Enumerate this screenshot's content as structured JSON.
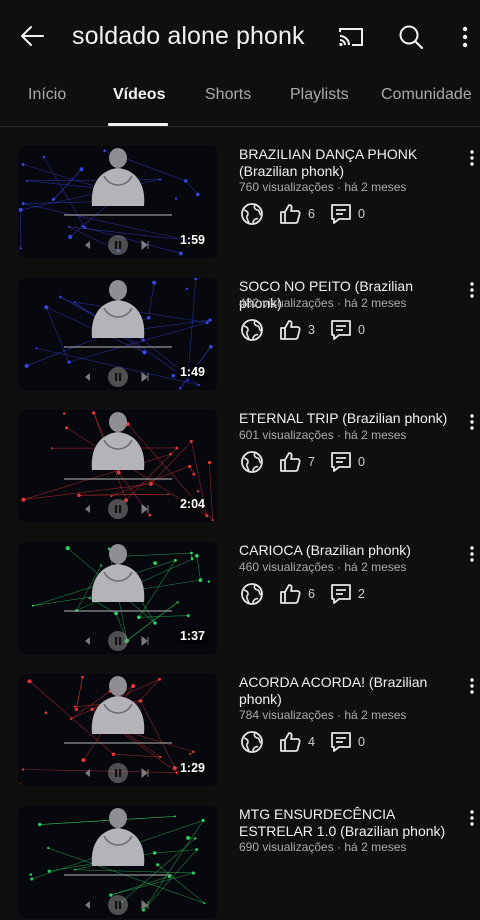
{
  "header": {
    "title": "soldado alone phonk"
  },
  "icons": {
    "back": "arrow-left-icon",
    "cast": "cast-icon",
    "search": "search-icon",
    "more": "more-vertical-icon",
    "globe": "globe-icon",
    "like": "thumbs-up-icon",
    "comment": "comment-icon"
  },
  "tabs": [
    {
      "label": "Início"
    },
    {
      "label": "Vídeos",
      "active": true
    },
    {
      "label": "Shorts"
    },
    {
      "label": "Playlists"
    },
    {
      "label": "Comunidade"
    }
  ],
  "videos": [
    {
      "title": "BRAZILIAN DANÇA PHONK (Brazilian phonk)",
      "meta": "760 visualizações · há 2 meses",
      "duration": "1:59",
      "likes": "6",
      "comments": "0",
      "accent": "#3a4cff"
    },
    {
      "title": "SOCO NO PEITO (Brazilian phonk)",
      "meta": "482 visualizações · há 2 meses",
      "duration": "1:49",
      "likes": "3",
      "comments": "0",
      "accent": "#3a4cff"
    },
    {
      "title": "ETERNAL TRIP (Brazilian phonk)",
      "meta": "601 visualizações · há 2 meses",
      "duration": "2:04",
      "likes": "7",
      "comments": "0",
      "accent": "#ff3b3b"
    },
    {
      "title": "CARIOCA (Brazilian phonk)",
      "meta": "460 visualizações · há 2 meses",
      "duration": "1:37",
      "likes": "6",
      "comments": "2",
      "accent": "#2ee86b"
    },
    {
      "title": "ACORDA ACORDA! (Brazilian phonk)",
      "meta": "784 visualizações · há 2 meses",
      "duration": "1:29",
      "likes": "4",
      "comments": "0",
      "accent": "#ff3b3b"
    },
    {
      "title": "MTG ENSURDECÊNCIA ESTRELAR 1.0 (Brazilian phonk)",
      "meta": "690 visualizações · há 2 meses",
      "duration": "",
      "likes": "",
      "comments": "",
      "accent": "#2ee86b"
    }
  ],
  "colors": {
    "background": "#0f0f0f",
    "text_primary": "#f1f1f1",
    "text_secondary": "#aaaaaa"
  }
}
